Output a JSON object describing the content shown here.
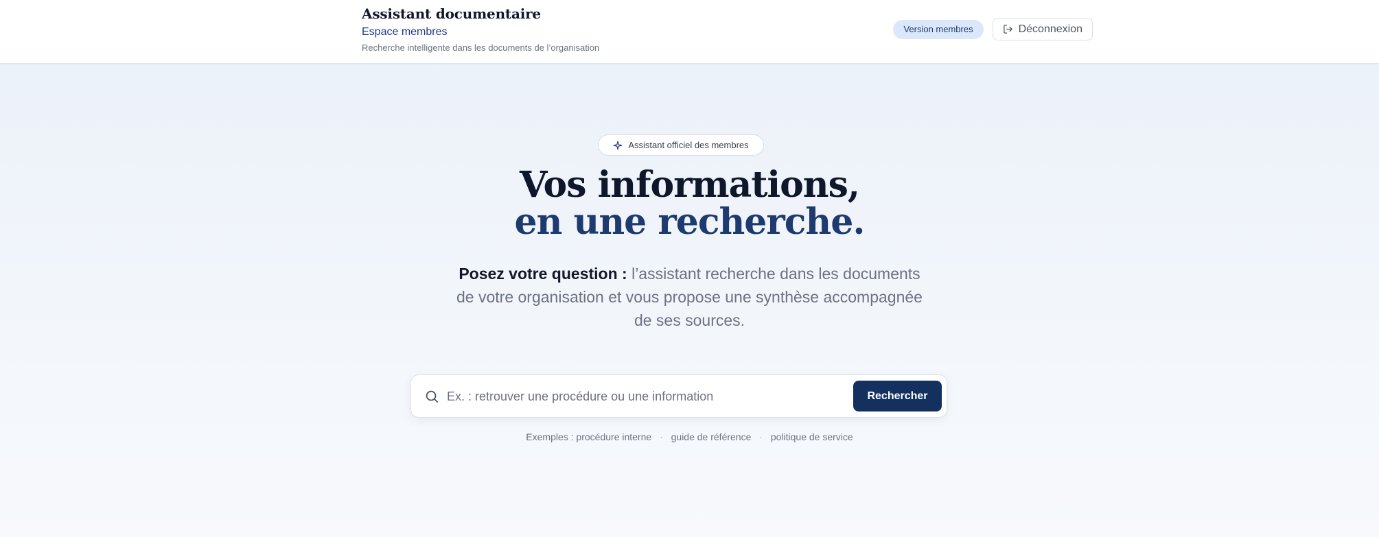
{
  "header": {
    "title": "Assistant documentaire",
    "subtitle": "Espace membres",
    "description": "Recherche intelligente dans les documents de l’organisation",
    "badge": "Version membres",
    "logout_label": "Déconnexion",
    "logout_icon": "logout-icon"
  },
  "hero": {
    "pill_label": "Assistant officiel des membres",
    "pill_icon": "sparkle-icon",
    "title_line1": "Vos informations,",
    "title_line2": "en une recherche.",
    "lead_strong": "Posez votre question :",
    "lead_rest": " l’assistant recherche dans les documents de votre organisation et vous propose une synthèse accompagnée de ses sources."
  },
  "search": {
    "placeholder": "Ex. : retrouver une procédure ou une information",
    "value": "",
    "button_label": "Rechercher",
    "icon": "search-icon"
  },
  "examples": {
    "prefix": "Exemples :",
    "items": [
      "procédure interne",
      "guide de référence",
      "politique de service"
    ],
    "separator": "·"
  },
  "colors": {
    "accent": "#13305f",
    "title_accent": "#1e3a6e",
    "badge_bg": "#dbe8fb"
  }
}
